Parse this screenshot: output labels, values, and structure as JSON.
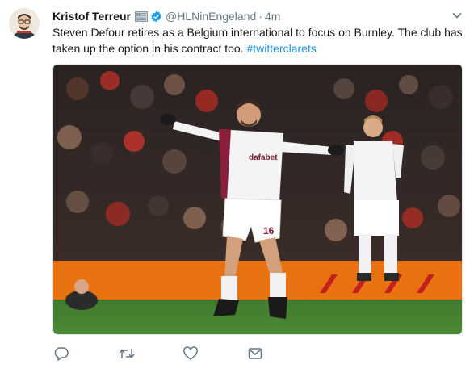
{
  "tweet": {
    "author_name": "Kristof Terreur",
    "handle": "@HLNinEngeland",
    "separator": "·",
    "time": "4m",
    "text_main": "Steven Defour retires as a Belgium international to focus on Burnley. The club has taken up the option in his contract too. ",
    "hashtag": "#twitterclarets",
    "jersey_sponsor": "dafabet",
    "jersey_number": "16"
  },
  "icons": {
    "reply": "reply-icon",
    "retweet": "retweet-icon",
    "like": "heart-icon",
    "dm": "envelope-icon",
    "menu": "chevron-down-icon",
    "verified": "verified-badge-icon"
  },
  "colors": {
    "link": "#1b95e0",
    "verified": "#1da1f2",
    "secondary_text": "#657786",
    "action_icon": "#657786"
  }
}
